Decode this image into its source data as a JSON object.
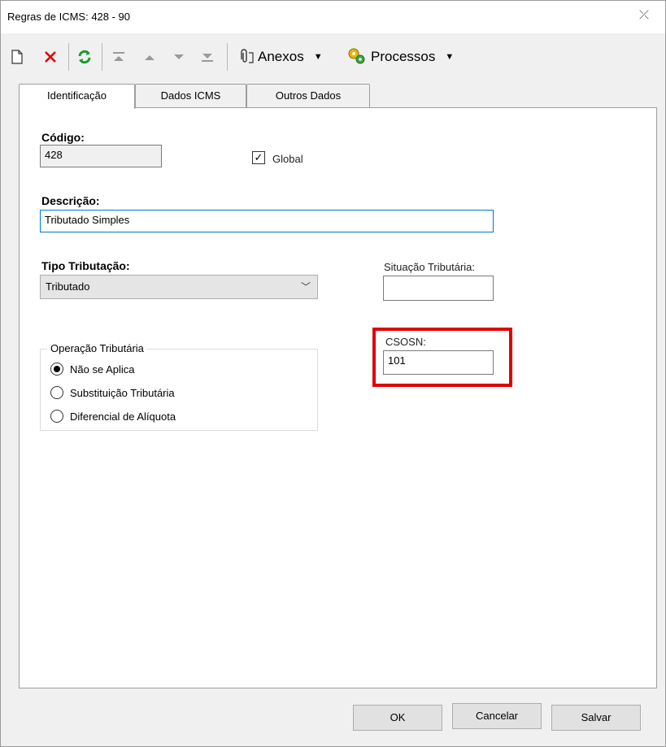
{
  "window": {
    "title": "Regras de ICMS: 428 - 90"
  },
  "toolbar": {
    "anexos_label": "Anexos",
    "processos_label": "Processos"
  },
  "tabs": [
    {
      "label": "Identificação",
      "active": true
    },
    {
      "label": "Dados ICMS"
    },
    {
      "label": "Outros Dados"
    }
  ],
  "form": {
    "codigo": {
      "label": "Código:",
      "value": "428"
    },
    "global": {
      "label": "Global",
      "checked": true
    },
    "descricao": {
      "label": "Descrição:",
      "value": "Tributado Simples"
    },
    "tipo_tributacao": {
      "label": "Tipo Tributação:",
      "value": "Tributado"
    },
    "situacao_tributaria": {
      "label": "Situação Tributária:",
      "value": ""
    },
    "csosn": {
      "label": "CSOSN:",
      "value": "101"
    },
    "operacao_tributaria": {
      "label": "Operação Tributária",
      "options": [
        "Não se Aplica",
        "Substituição Tributária",
        "Diferencial de Alíquota"
      ],
      "selected": "Não se Aplica"
    }
  },
  "buttons": {
    "ok": "OK",
    "cancel": "Cancelar",
    "save": "Salvar"
  },
  "colors": {
    "highlight": "#e00000",
    "accent": "#0078d7"
  }
}
